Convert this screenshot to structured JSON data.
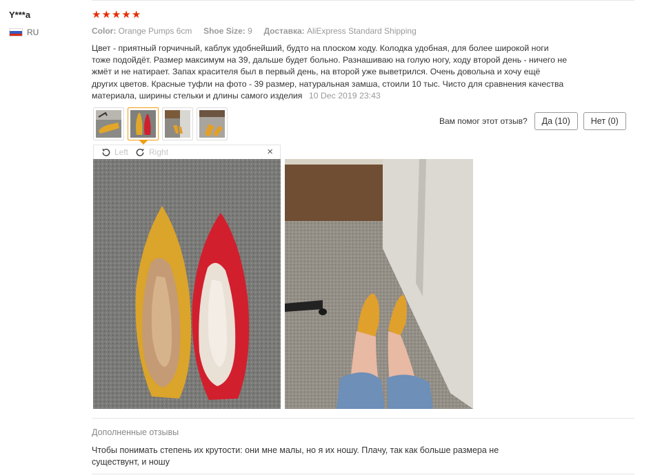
{
  "reviewer": {
    "name": "Y***a",
    "country_code": "RU",
    "flag_icon": "russia-flag-icon"
  },
  "rating": {
    "stars": 5,
    "star_color": "#e62e04"
  },
  "meta": {
    "color_label": "Color:",
    "color_value": "Orange Pumps 6cm",
    "size_label": "Shoe Size:",
    "size_value": "9",
    "shipping_label": "Доставка:",
    "shipping_value": "AliExpress Standard Shipping"
  },
  "review": {
    "text": "Цвет - приятный горчичный, каблук удобнейший, будто на плоском ходу. Колодка удобная, для более широкой ноги тоже подойдёт. Размер максимум на 39, дальше будет больно. Разнашиваю на голую ногу, ходу второй день - ничего не жмёт и не натирает. Запах красителя был в первый день, на второй уже выветрился. Очень довольна и хочу ещё других цветов. Красные туфли на фото - 39 размер, натуральная замша, стоили 10 тыс. Чисто для сравнения качества материала, ширины стельки и длины самого изделия",
    "date": "10 Dec 2019 23:43"
  },
  "thumbnails": [
    {
      "name": "thumbnail-1",
      "active": false
    },
    {
      "name": "thumbnail-2",
      "active": true
    },
    {
      "name": "thumbnail-3",
      "active": false
    },
    {
      "name": "thumbnail-4",
      "active": false
    }
  ],
  "helpful": {
    "label": "Вам помог этот отзыв?",
    "yes_label": "Да (10)",
    "no_label": "Нет (0)"
  },
  "viewer": {
    "rotate_left": "Left",
    "rotate_right": "Right",
    "close": "×"
  },
  "additional": {
    "title": "Дополненные отзывы",
    "text": "Чтобы понимать степень их крутости: они мне малы, но я их ношу. Плачу, так как больше размера не существунт, и ношу"
  },
  "colors": {
    "accent": "#f39c12",
    "star": "#e62e04",
    "mustard": "#e0a82a",
    "red": "#d0202e"
  }
}
